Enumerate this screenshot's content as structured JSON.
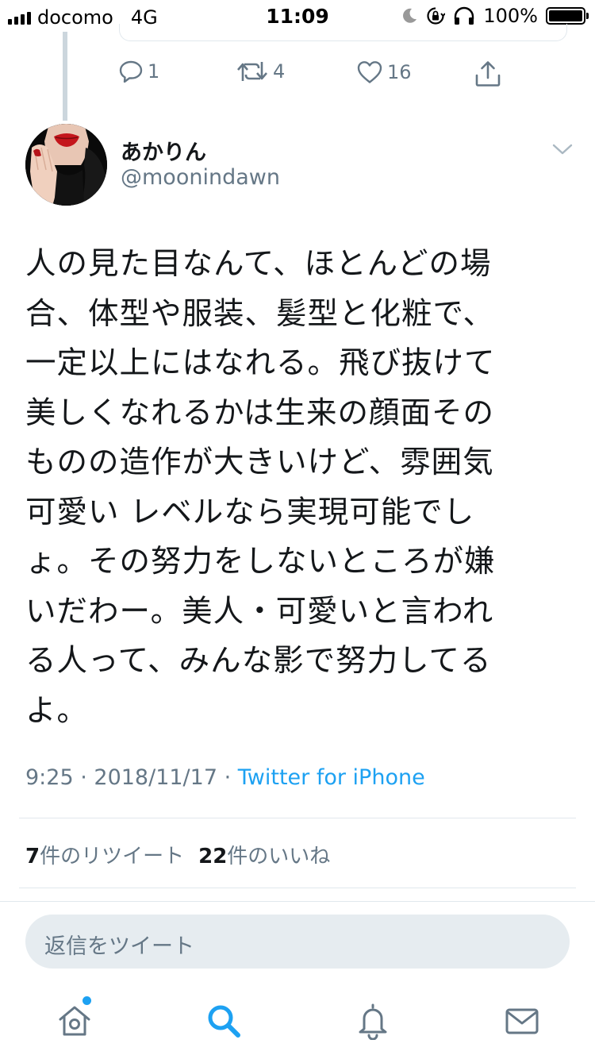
{
  "status_bar": {
    "carrier": "docomo",
    "network": "4G",
    "time": "11:09",
    "battery": "100%",
    "battery_level": 1.0,
    "icons": [
      "moon-icon",
      "orientation-lock-icon",
      "headphones-icon"
    ]
  },
  "previous_tweet": {
    "reply_count": "1",
    "retweet_count": "4",
    "like_count": "16"
  },
  "tweet": {
    "display_name": "あかりん",
    "handle": "@moonindawn",
    "text": "人の見た目なんて、ほとんどの場\n合、体型や服装、髪型と化粧で、\n一定以上にはなれる。飛び抜けて\n美しくなれるかは生来の顔面その\nものの造作が大きいけど、雰囲気\n可愛い レベルなら実現可能でし\nょ。その努力をしないところが嫌\nいだわー。美人・可愛いと言われ\nる人って、みんな影で努力してる\nよ。",
    "time": "9:25",
    "sep1": " · ",
    "date": "2018/11/17",
    "sep2": " · ",
    "source": "Twitter for iPhone",
    "retweets_num": "7",
    "retweets_label": "件のリツイート",
    "likes_num": "22",
    "likes_label": "件のいいね"
  },
  "reply": {
    "placeholder": "返信をツイート"
  },
  "colors": {
    "accent": "#1da1f2",
    "secondary_text": "#657786",
    "divider": "#e1e8ed",
    "input_bg": "#e6ecf0"
  },
  "tab_bar": {
    "tabs": [
      "home-icon",
      "search-icon",
      "notifications-icon",
      "messages-icon"
    ],
    "active": "search-icon"
  }
}
